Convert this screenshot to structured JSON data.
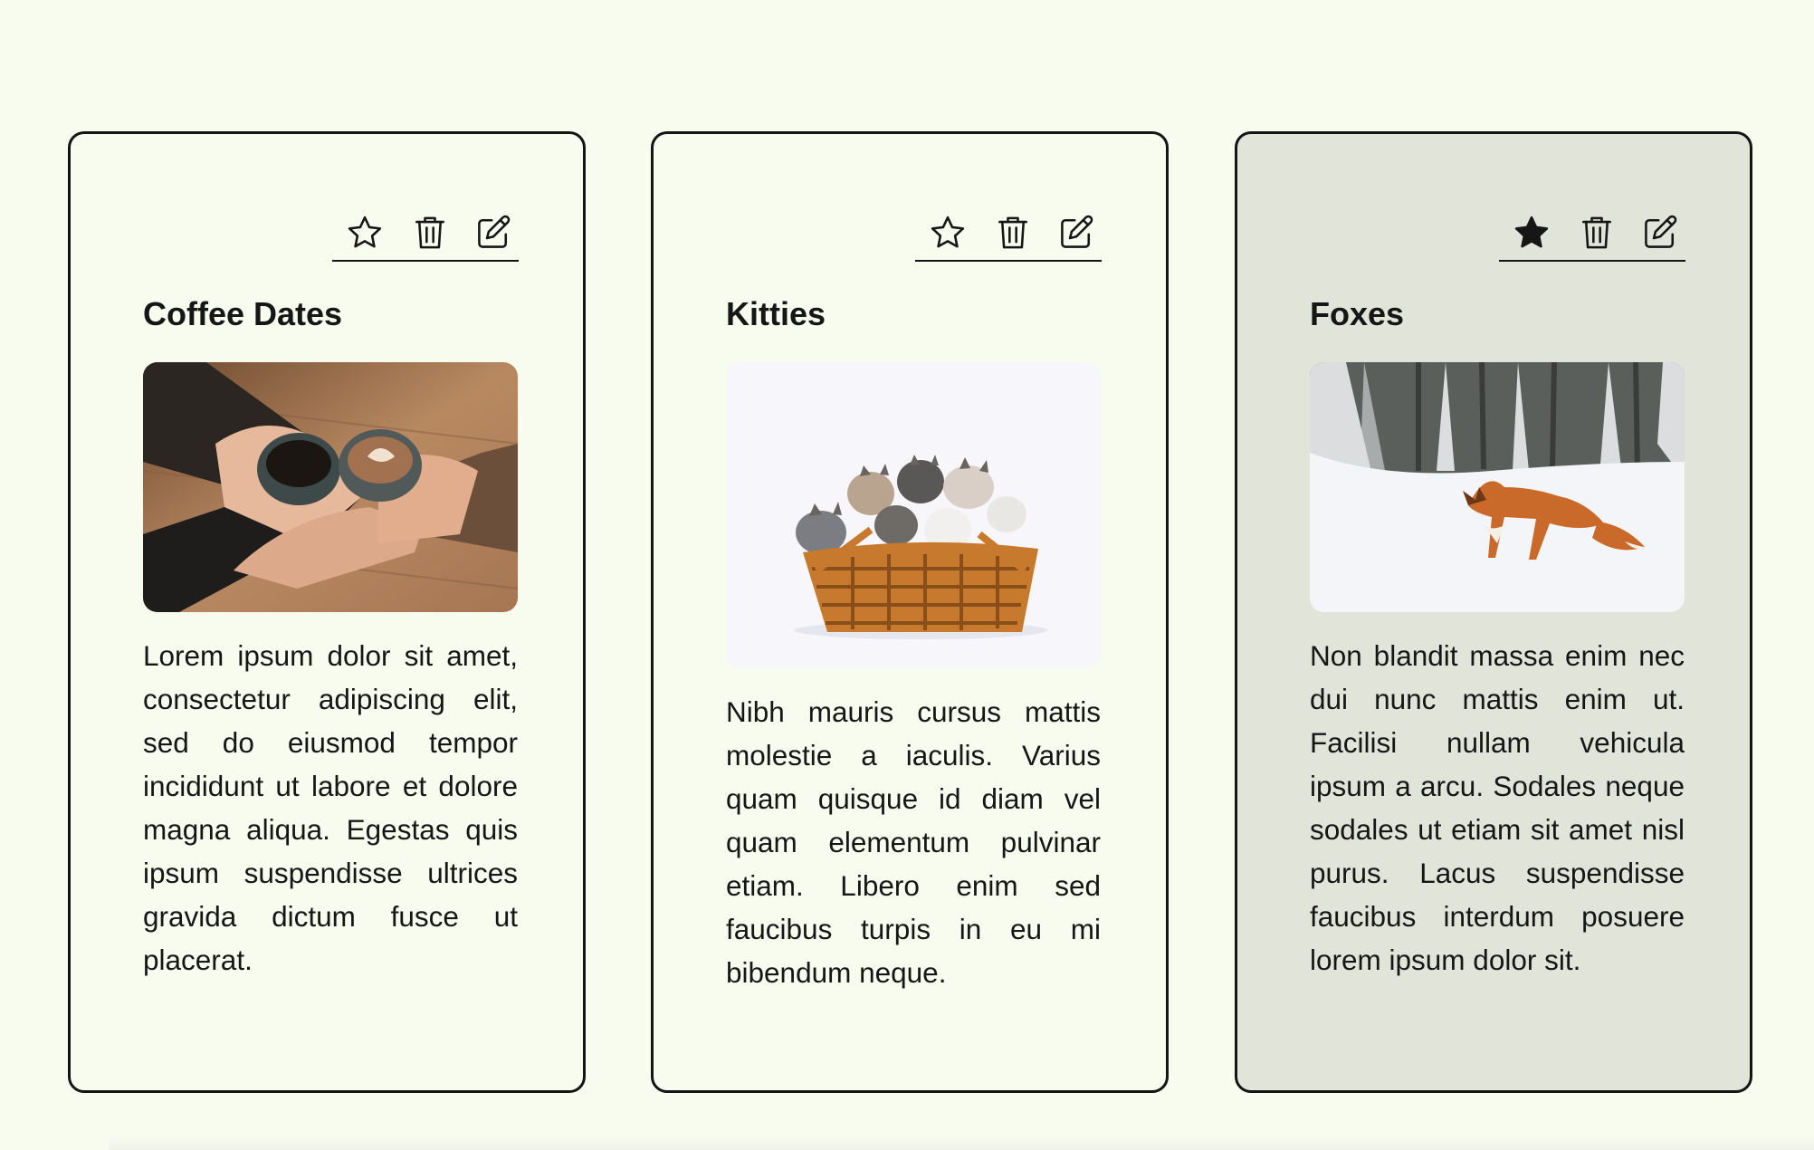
{
  "colors": {
    "page_background": "#f8fcef",
    "card_background": "#f8fcef",
    "selected_card_background": "#e1e4d9",
    "border": "#141414"
  },
  "cards": [
    {
      "title": "Coffee Dates",
      "favorited": false,
      "favorite_icon": "star-outline-icon",
      "delete_icon": "trash-icon",
      "edit_icon": "pencil-square-icon",
      "image": "coffee-cups-photo",
      "body": "Lorem ipsum dolor sit amet, consectetur adipiscing elit, sed do eiusmod tempor incididunt ut labore et dolore magna aliqua. Egestas quis ipsum suspendisse ultrices gravida dictum fusce ut placerat."
    },
    {
      "title": "Kitties",
      "favorited": false,
      "favorite_icon": "star-outline-icon",
      "delete_icon": "trash-icon",
      "edit_icon": "pencil-square-icon",
      "image": "kittens-in-basket-photo",
      "body": "Nibh mauris cursus mattis molestie a iaculis. Varius quam quisque id diam vel quam elementum pulvinar etiam. Libero enim sed faucibus turpis in eu mi bibendum neque."
    },
    {
      "title": "Foxes",
      "favorited": true,
      "favorite_icon": "star-filled-icon",
      "delete_icon": "trash-icon",
      "edit_icon": "pencil-square-icon",
      "image": "fox-in-snow-photo",
      "body": "Non blandit massa enim nec dui nunc mattis enim ut. Facilisi nullam vehicula ipsum a arcu. Sodales neque sodales ut etiam sit amet nisl purus. Lacus suspendisse faucibus interdum posuere lorem ipsum dolor sit."
    }
  ]
}
